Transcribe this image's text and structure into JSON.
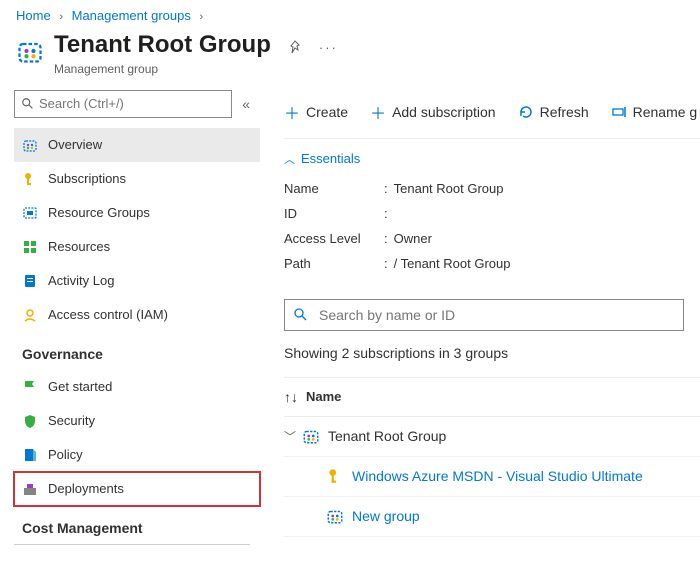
{
  "breadcrumb": {
    "home": "Home",
    "mg": "Management groups"
  },
  "header": {
    "title": "Tenant Root Group",
    "subtitle": "Management group"
  },
  "toolbar": {
    "create": "Create",
    "add_subscription": "Add subscription",
    "refresh": "Refresh",
    "rename": "Rename g"
  },
  "sidebar": {
    "search_placeholder": "Search (Ctrl+/)",
    "items": [
      "Overview",
      "Subscriptions",
      "Resource Groups",
      "Resources",
      "Activity Log",
      "Access control (IAM)"
    ],
    "governance_label": "Governance",
    "gov_items": [
      "Get started",
      "Security",
      "Policy",
      "Deployments"
    ],
    "cost_label": "Cost Management"
  },
  "essentials": {
    "header": "Essentials",
    "name_label": "Name",
    "name_value": "Tenant Root Group",
    "id_label": "ID",
    "id_value": "",
    "access_label": "Access Level",
    "access_value": "Owner",
    "path_label": "Path",
    "path_value": "/ Tenant Root Group"
  },
  "subs": {
    "search_placeholder": "Search by name or ID",
    "showing": "Showing 2 subscriptions in 3 groups",
    "col_name": "Name",
    "rows": [
      {
        "name": "Tenant Root Group",
        "type": "mg",
        "level": 0,
        "link": false
      },
      {
        "name": "Windows Azure MSDN - Visual Studio Ultimate",
        "type": "sub",
        "level": 1,
        "link": true
      },
      {
        "name": "New group",
        "type": "mg",
        "level": 1,
        "link": true
      }
    ]
  }
}
